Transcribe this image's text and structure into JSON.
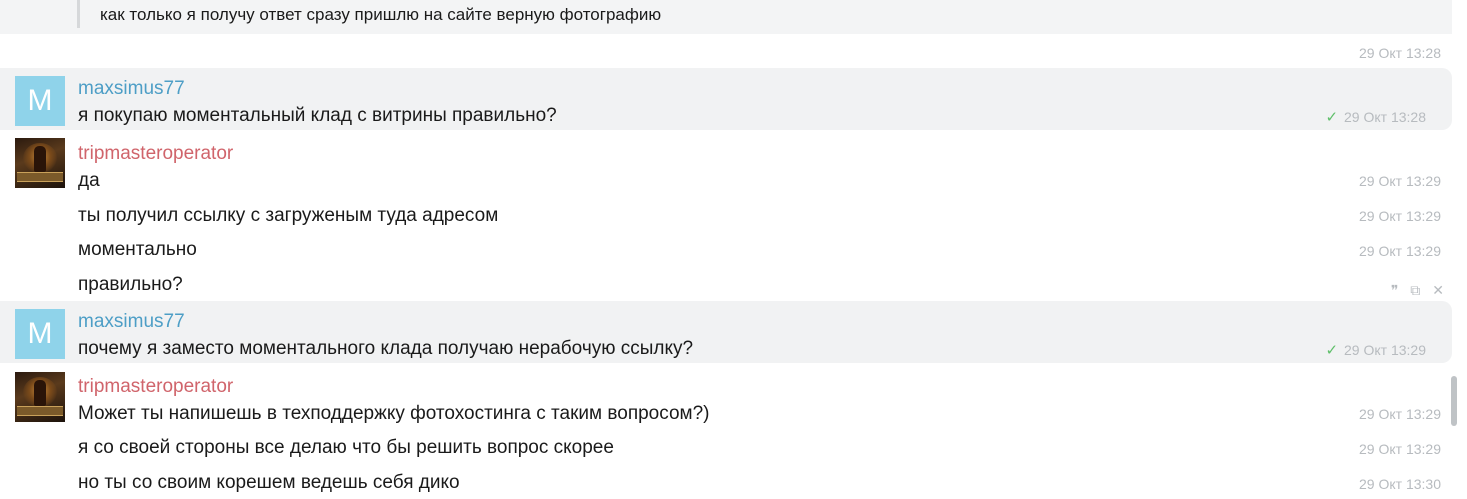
{
  "quote_tail": {
    "text": "как только я получу ответ сразу пришлю на сайте верную фотографию",
    "time": "29 Окт 13:28"
  },
  "messages": [
    {
      "author": "maxsimus77",
      "avatar_letter": "M",
      "lines": [
        {
          "text": "я покупаю моментальный клад с витрины правильно?",
          "time": "29 Окт 13:28",
          "read": true
        }
      ]
    },
    {
      "author": "tripmasteroperator",
      "lines": [
        {
          "text": "да",
          "time": "29 Окт 13:29"
        },
        {
          "text": "ты получил ссылку с загруженым туда адресом",
          "time": "29 Окт 13:29"
        },
        {
          "text": "моментально",
          "time": "29 Окт 13:29"
        },
        {
          "text": "правильно?",
          "time": ""
        }
      ]
    },
    {
      "author": "maxsimus77",
      "avatar_letter": "M",
      "lines": [
        {
          "text": "почему я заместо моментального клада получаю нерабочую ссылку?",
          "time": "29 Окт 13:29",
          "read": true
        }
      ]
    },
    {
      "author": "tripmasteroperator",
      "lines": [
        {
          "text": "Может ты напишешь в техподдержку фотохостинга с таким вопросом?)",
          "time": "29 Окт 13:29"
        },
        {
          "text": "я со своей стороны все делаю что бы решить вопрос скорее",
          "time": "29 Окт 13:29"
        },
        {
          "text": "но ты со своим корешем ведешь себя дико",
          "time": "29 Окт 13:30"
        }
      ]
    }
  ],
  "actions": {
    "quote_icon": "quote-icon",
    "copy_icon": "copy-icon",
    "delete_icon": "close-icon"
  },
  "colors": {
    "user_blue": "#4d9ec6",
    "operator_red": "#d0646b",
    "timestamp": "#b7bbbf",
    "read_check": "#5fbf6a",
    "avatar_bg": "#8fd3ea",
    "highlight_bg": "#f1f2f3"
  }
}
